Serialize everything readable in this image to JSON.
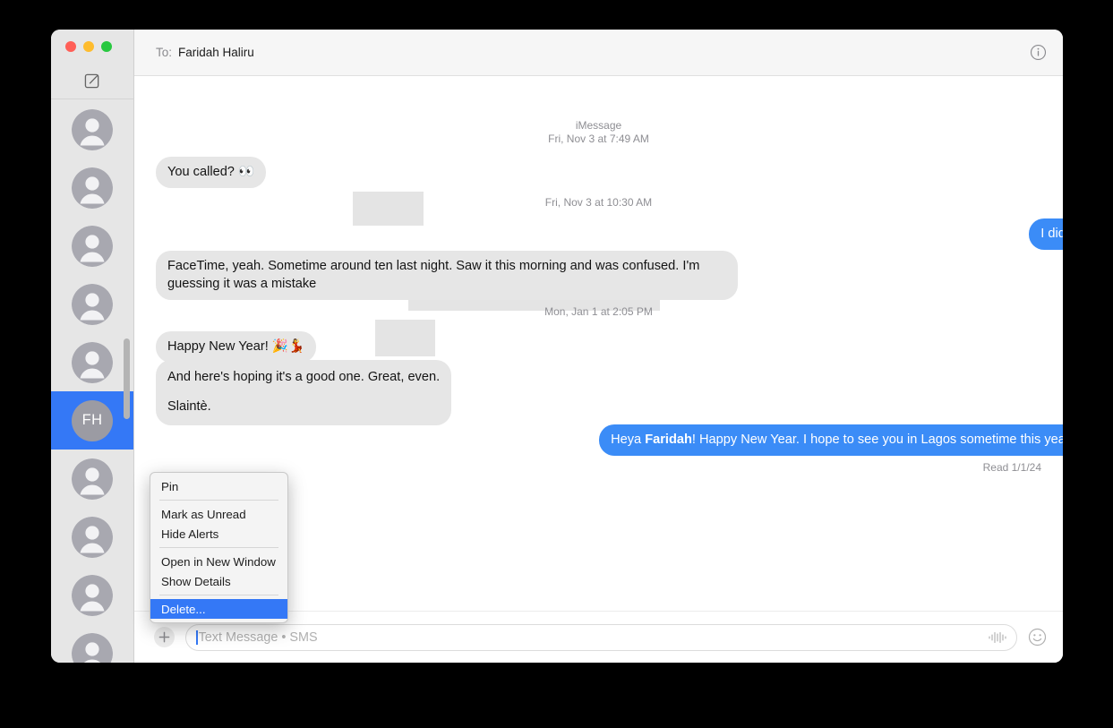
{
  "window": {
    "traffic_lights": [
      {
        "name": "close",
        "color": "#ff5f57"
      },
      {
        "name": "minimize",
        "color": "#febc2e"
      },
      {
        "name": "zoom",
        "color": "#28c840"
      }
    ],
    "compose_icon": "compose-icon"
  },
  "sidebar": {
    "scrollbar": true,
    "conversations": [
      {
        "avatar_type": "generic",
        "initials": "",
        "selected": false
      },
      {
        "avatar_type": "generic",
        "initials": "",
        "selected": false
      },
      {
        "avatar_type": "generic",
        "initials": "",
        "selected": false
      },
      {
        "avatar_type": "generic",
        "initials": "",
        "selected": false
      },
      {
        "avatar_type": "generic",
        "initials": "",
        "selected": false
      },
      {
        "avatar_type": "initials",
        "initials": "FH",
        "selected": true
      },
      {
        "avatar_type": "generic",
        "initials": "",
        "selected": false
      },
      {
        "avatar_type": "generic",
        "initials": "",
        "selected": false
      },
      {
        "avatar_type": "generic",
        "initials": "",
        "selected": false
      },
      {
        "avatar_type": "generic",
        "initials": "",
        "selected": false
      }
    ]
  },
  "header": {
    "to_label": "To:",
    "recipient": "Faridah Haliru",
    "info_icon": "info-circle-icon"
  },
  "conversation": {
    "service_label": "iMessage",
    "stamp_1": "Fri, Nov 3 at 7:49 AM",
    "stamp_2": "Fri, Nov 3 at 10:30 AM",
    "stamp_3": "Mon, Jan 1 at 2:05 PM",
    "msg_1": "You called? 👀",
    "msg_2": "I did?",
    "msg_3": "FaceTime, yeah. Sometime around ten last night. Saw it this morning and was confused. I'm guessing it was a mistake",
    "msg_4": "Happy New Year! 🎉💃",
    "msg_5_line1": "And here's hoping it's a good one. Great, even.",
    "msg_5_line2": "Slaintè.",
    "msg_6_prefix": "Heya ",
    "msg_6_bold": "Faridah",
    "msg_6_suffix": "! Happy New Year. I hope to see you in Lagos sometime this year.",
    "read_receipt": "Read 1/1/24"
  },
  "composer": {
    "plus_label": "+",
    "placeholder": "Text Message • SMS",
    "audio_icon": "audio-waveform-icon",
    "emoji_icon": "smiley-face-icon"
  },
  "context_menu": {
    "items": [
      {
        "label": "Pin",
        "highlighted": false,
        "separator_after": true
      },
      {
        "label": "Mark as Unread",
        "highlighted": false,
        "separator_after": false
      },
      {
        "label": "Hide Alerts",
        "highlighted": false,
        "separator_after": true
      },
      {
        "label": "Open in New Window",
        "highlighted": false,
        "separator_after": false
      },
      {
        "label": "Show Details",
        "highlighted": false,
        "separator_after": true
      },
      {
        "label": "Delete...",
        "highlighted": true,
        "separator_after": false
      }
    ]
  },
  "colors": {
    "accent_blue": "#3478f6",
    "bubble_blue": "#3b8cf7",
    "bubble_gray": "#e6e6e6",
    "sidebar_bg": "#e6e6e6",
    "header_bg": "#f6f6f6"
  }
}
